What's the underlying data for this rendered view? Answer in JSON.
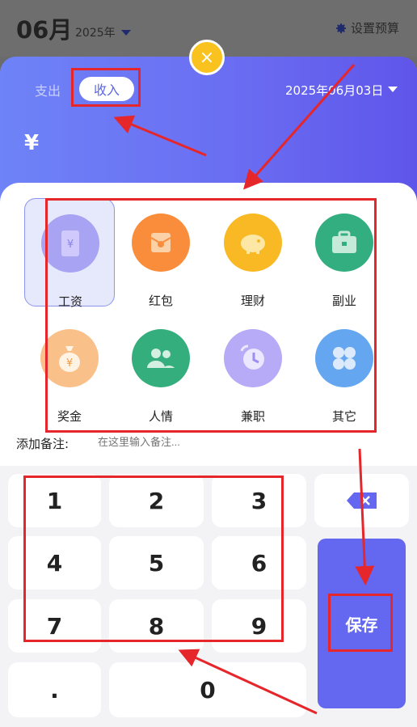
{
  "header": {
    "month": "06月",
    "year": "2025年",
    "budget_label": "设置预算"
  },
  "sheet": {
    "close_glyph": "×",
    "tabs": [
      {
        "label": "支出",
        "active": false
      },
      {
        "label": "收入",
        "active": true
      }
    ],
    "date": "2025年06月03日",
    "currency": "¥"
  },
  "categories": [
    {
      "label": "工资",
      "icon": "salary-icon",
      "color": "#a9a3f3",
      "selected": true
    },
    {
      "label": "红包",
      "icon": "red-envelope-icon",
      "color": "#f98d3c"
    },
    {
      "label": "理财",
      "icon": "piggy-bank-icon",
      "color": "#f8b925"
    },
    {
      "label": "副业",
      "icon": "briefcase-icon",
      "color": "#33ae80"
    },
    {
      "label": "奖金",
      "icon": "money-bag-icon",
      "color": "#f9c08a"
    },
    {
      "label": "人情",
      "icon": "people-icon",
      "color": "#34ae7c"
    },
    {
      "label": "兼职",
      "icon": "clock-icon",
      "color": "#b7aaf6"
    },
    {
      "label": "其它",
      "icon": "grid-icon",
      "color": "#64a7f0"
    }
  ],
  "note": {
    "label": "添加备注:",
    "placeholder": "在这里输入备注..."
  },
  "keypad": {
    "keys": [
      "1",
      "2",
      "3",
      "4",
      "5",
      "6",
      "7",
      "8",
      "9",
      ".",
      "0"
    ],
    "save_label": "保存",
    "backspace_icon": "backspace-icon",
    "accent": "#6468f0"
  }
}
